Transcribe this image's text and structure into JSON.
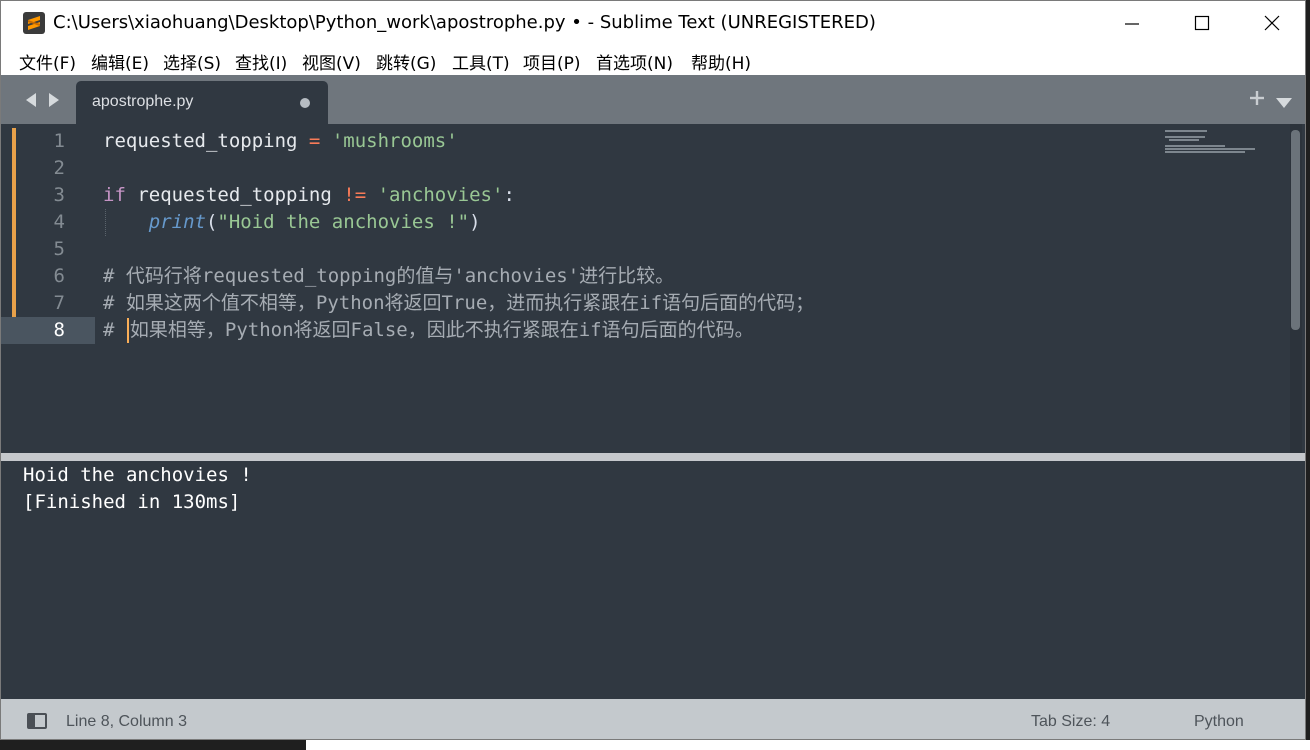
{
  "window": {
    "title": "C:\\Users\\xiaohuang\\Desktop\\Python_work\\apostrophe.py • - Sublime Text (UNREGISTERED)",
    "app_icon": "sublime-text-icon",
    "controls": [
      "minimize-icon",
      "maximize-icon",
      "close-icon"
    ]
  },
  "menu": [
    {
      "label": "文件(F)"
    },
    {
      "label": "编辑(E)"
    },
    {
      "label": "选择(S)"
    },
    {
      "label": "查找(I)"
    },
    {
      "label": "视图(V)"
    },
    {
      "label": "跳转(G)"
    },
    {
      "label": "工具(T)"
    },
    {
      "label": "项目(P)"
    },
    {
      "label": "首选项(N)"
    },
    {
      "label": "帮助(H)"
    }
  ],
  "tabs": [
    {
      "label": "apostrophe.py",
      "modified": true,
      "active": true
    }
  ],
  "editor": {
    "line_numbers": [
      "1",
      "2",
      "3",
      "4",
      "5",
      "6",
      "7",
      "8"
    ],
    "active_line": "8",
    "lines": {
      "l1": {
        "var": "requested_topping",
        "op": "=",
        "str": "'mushrooms'"
      },
      "l3": {
        "kw": "if",
        "var": "requested_topping",
        "op": "!=",
        "str": "'anchovies'",
        "punc": ":"
      },
      "l4": {
        "fn": "print",
        "open": "(",
        "str": "\"Hoid the anchovies !\"",
        "close": ")"
      },
      "l6": "# 代码行将requested_topping的值与'anchovies'进行比较。",
      "l7": "# 如果这两个值不相等，Python将返回True，进而执行紧跟在if语句后面的代码；",
      "l8": {
        "hash": "#",
        "text": "如果相等，Python将返回False，因此不执行紧跟在if语句后面的代码。"
      }
    }
  },
  "output": {
    "lines": [
      "Hoid the anchovies !",
      "[Finished in 130ms]"
    ]
  },
  "status": {
    "position": "Line 8, Column 3",
    "tab_size": "Tab Size: 4",
    "syntax": "Python"
  },
  "colors": {
    "editor_bg": "#303841",
    "tab_bar": "#6f767d",
    "status_bar": "#c4c9cd",
    "keyword": "#c594c5",
    "string": "#99c794",
    "operator": "#f97b58",
    "function": "#6699cc",
    "modified_marker": "#e8a14a"
  }
}
